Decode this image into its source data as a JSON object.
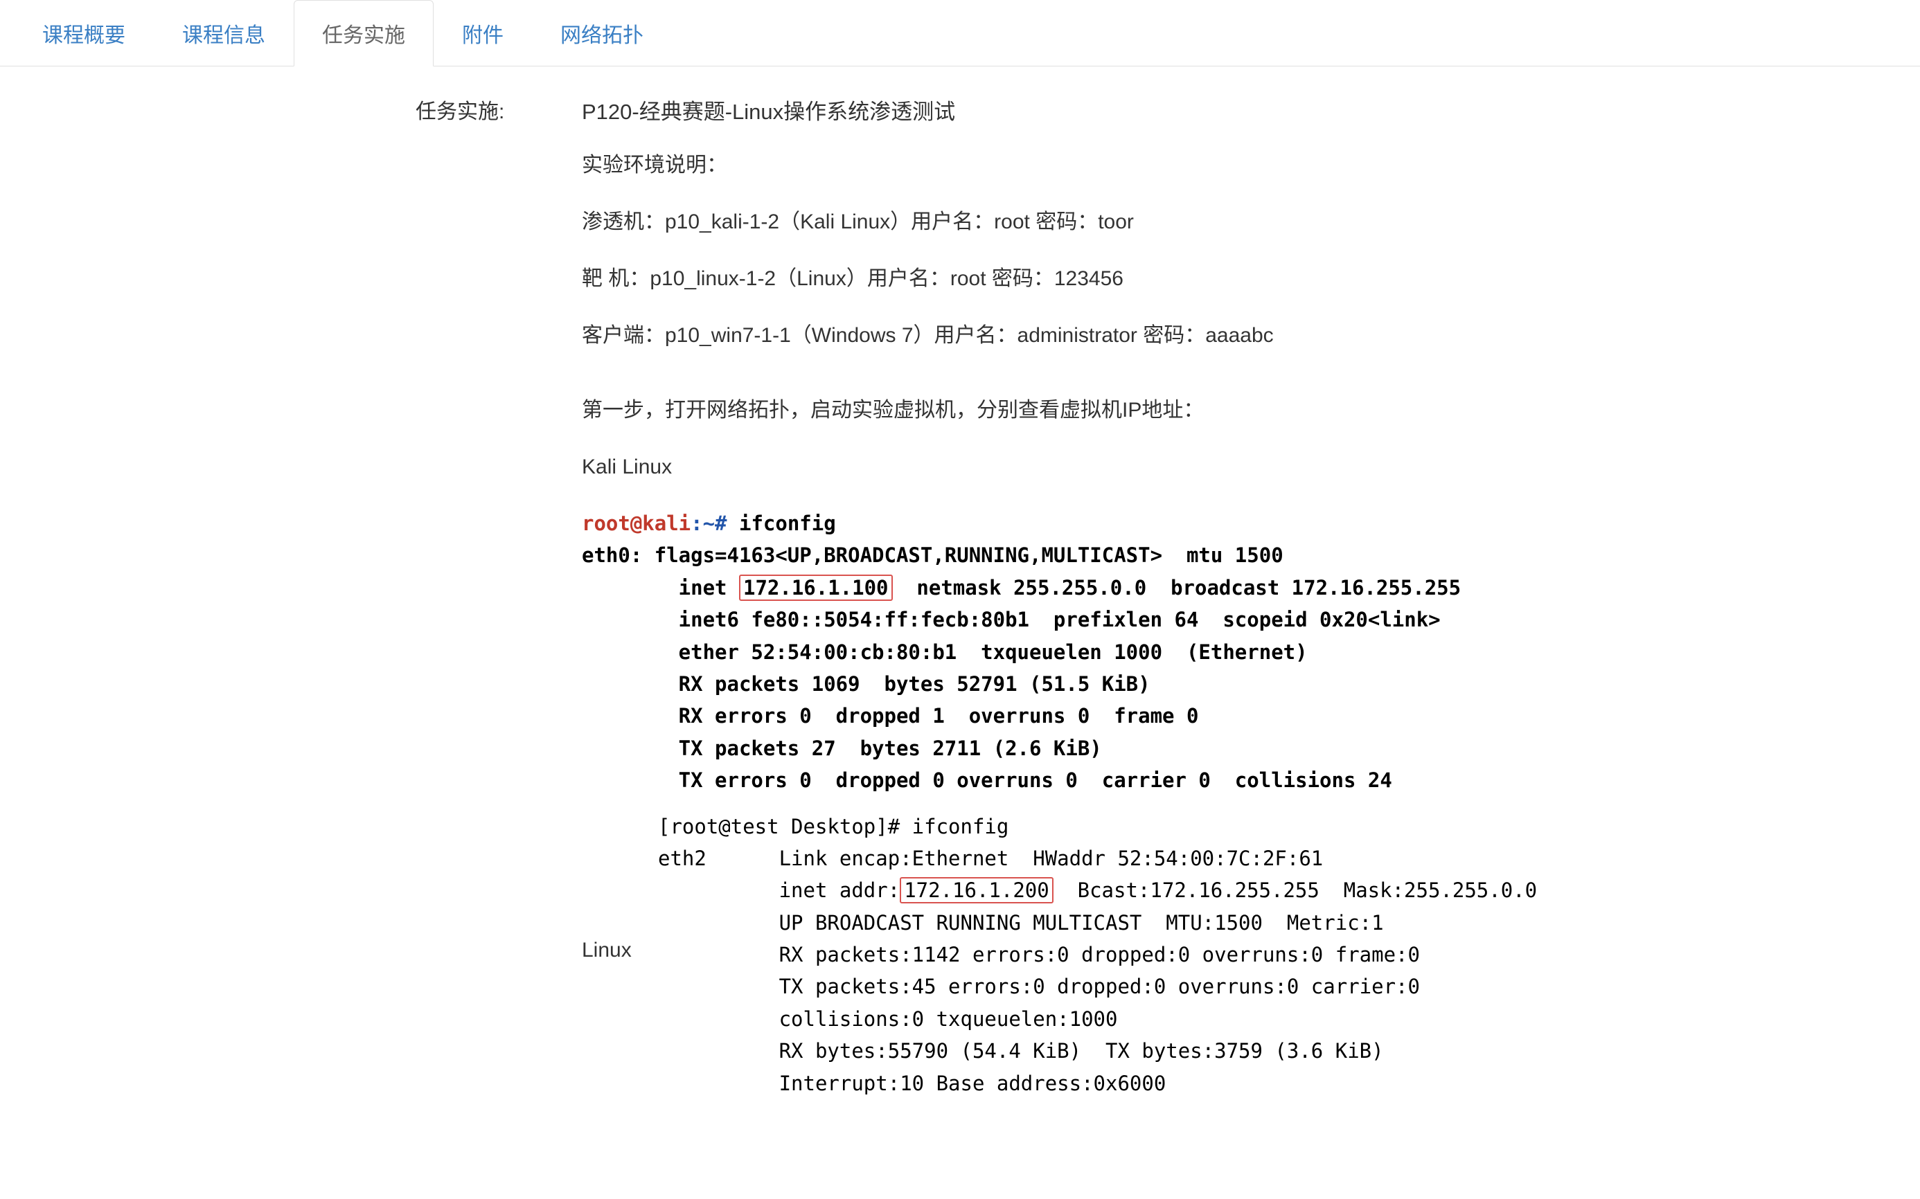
{
  "tabs": [
    {
      "label": "课程概要"
    },
    {
      "label": "课程信息"
    },
    {
      "label": "任务实施"
    },
    {
      "label": "附件"
    },
    {
      "label": "网络拓扑"
    }
  ],
  "activeTabIndex": 2,
  "sectionLabel": "任务实施:",
  "content": {
    "title": "P120-经典赛题-Linux操作系统渗透测试",
    "envHeader": "实验环境说明：",
    "machines": [
      "渗透机：p10_kali-1-2（Kali Linux）用户名：root 密码：toor",
      "靶   机：p10_linux-1-2（Linux）用户名：root 密码：123456",
      "客户端：p10_win7-1-1（Windows 7）用户名：administrator 密码：aaaabc"
    ],
    "step1": "第一步，打开网络拓扑，启动实验虚拟机，分别查看虚拟机IP地址：",
    "kaliLabel": "Kali Linux",
    "kaliTerminal": {
      "promptUser": "root@kali",
      "promptHome": ":~#",
      "cmd": "ifconfig",
      "line1a": "eth0: flags=4163<UP,BROADCAST,RUNNING,MULTICAST>  mtu 1500",
      "line2_pre": "        inet ",
      "line2_ip": "172.16.1.100",
      "line2_post": "  netmask 255.255.0.0  broadcast 172.16.255.255",
      "line3": "        inet6 fe80::5054:ff:fecb:80b1  prefixlen 64  scopeid 0x20<link>",
      "line4": "        ether 52:54:00:cb:80:b1  txqueuelen 1000  (Ethernet)",
      "line5": "        RX packets 1069  bytes 52791 (51.5 KiB)",
      "line6": "        RX errors 0  dropped 1  overruns 0  frame 0",
      "line7": "        TX packets 27  bytes 2711 (2.6 KiB)",
      "line8": "        TX errors 0  dropped 0 overruns 0  carrier 0  collisions 24"
    },
    "linuxLabel": "Linux",
    "linuxTerminal": {
      "line0": "[root@test Desktop]# ifconfig",
      "line1": "eth2      Link encap:Ethernet  HWaddr 52:54:00:7C:2F:61",
      "line2_pre": "          inet addr:",
      "line2_ip": "172.16.1.200",
      "line2_post": "  Bcast:172.16.255.255  Mask:255.255.0.0",
      "line3": "          UP BROADCAST RUNNING MULTICAST  MTU:1500  Metric:1",
      "line4": "          RX packets:1142 errors:0 dropped:0 overruns:0 frame:0",
      "line5": "          TX packets:45 errors:0 dropped:0 overruns:0 carrier:0",
      "line6": "          collisions:0 txqueuelen:1000",
      "line7": "          RX bytes:55790 (54.4 KiB)  TX bytes:3759 (3.6 KiB)",
      "line8": "          Interrupt:10 Base address:0x6000"
    }
  }
}
